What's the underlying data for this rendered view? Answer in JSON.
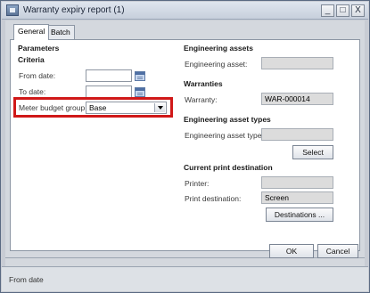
{
  "window": {
    "title": "Warranty expiry report (1)",
    "controls": {
      "minimize": "_",
      "maximize": "□",
      "close": "X"
    }
  },
  "tabs": [
    {
      "label": "General",
      "active": true
    },
    {
      "label": "Batch",
      "active": false
    }
  ],
  "parameters": {
    "heading": "Parameters",
    "criteria_heading": "Criteria",
    "from_date": {
      "label": "From date:",
      "value": ""
    },
    "to_date": {
      "label": "To date:",
      "value": ""
    },
    "meter_budget_group": {
      "label": "Meter budget group:",
      "value": "Base"
    }
  },
  "engineering_assets": {
    "heading": "Engineering assets",
    "asset": {
      "label": "Engineering asset:",
      "value": ""
    }
  },
  "warranties": {
    "heading": "Warranties",
    "warranty": {
      "label": "Warranty:",
      "value": "WAR-000014"
    }
  },
  "asset_types": {
    "heading": "Engineering asset types",
    "type": {
      "label": "Engineering asset type:",
      "value": ""
    },
    "select_label": "Select"
  },
  "print_destination": {
    "heading": "Current print destination",
    "printer": {
      "label": "Printer:",
      "value": ""
    },
    "destination": {
      "label": "Print destination:",
      "value": "Screen"
    },
    "destinations_label": "Destinations ..."
  },
  "footer": {
    "ok_label": "OK",
    "cancel_label": "Cancel"
  },
  "status": {
    "text": "From date"
  },
  "colors": {
    "highlight": "#d01818",
    "titlebar": "#c7cfdc",
    "dialog_bg": "#d4d8de"
  }
}
